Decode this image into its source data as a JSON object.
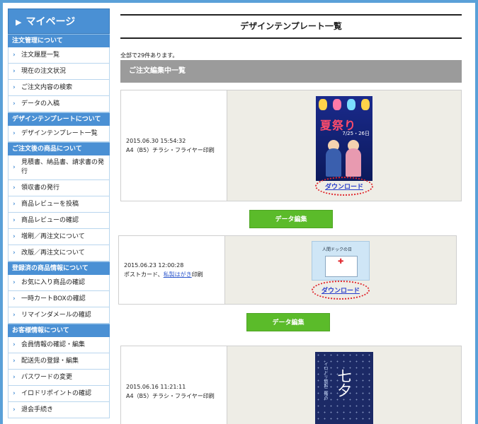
{
  "sidebar": {
    "mypage": "マイページ",
    "sections": [
      {
        "title": "注文管理について",
        "items": [
          "注文履歴一覧",
          "現在の注文状況",
          "ご注文内容の検索",
          "データの入稿"
        ]
      },
      {
        "title": "デザインテンプレートについて",
        "items": [
          "デザインテンプレート一覧"
        ]
      },
      {
        "title": "ご注文後の商品について",
        "items": [
          "見積書、納品書、請求書の発行",
          "領収書の発行",
          "商品レビューを投稿",
          "商品レビューの確認",
          "増刷／再注文について",
          "改版／再注文について"
        ]
      },
      {
        "title": "登録済の商品情報について",
        "items": [
          "お気に入り商品の確認",
          "一時カートBOXの確認",
          "リマインダメールの確認"
        ]
      },
      {
        "title": "お客様情報について",
        "items": [
          "会員情報の確認・編集",
          "配送先の登録・編集",
          "パスワードの変更",
          "イロドリポイントの確認",
          "退会手続き"
        ]
      }
    ]
  },
  "main": {
    "title": "デザインテンプレート一覧",
    "count": "全部で29件あります。",
    "banner": "ご注文編集中一覧",
    "download_label": "ダウンロード",
    "edit_label": "データ編集",
    "orders": [
      {
        "datetime": "2015.06.30 15:54:32",
        "product": "A4（B5）チラシ・フライヤー印刷",
        "poster_title": "夏祭り",
        "poster_date": "7/25・26日"
      },
      {
        "datetime": "2015.06.23 12:00:28",
        "product_prefix": "ポストカード、",
        "product_link": "私製はがき",
        "product_suffix": "印刷",
        "poster_text": "人間ドックの日"
      },
      {
        "datetime": "2015.06.16 11:21:11",
        "product": "A4（B5）チラシ・フライヤー印刷",
        "poster_title": "七夕",
        "poster_sub": "イロドリ旅館二階の"
      }
    ]
  },
  "colors": {
    "accent": "#4a90d4",
    "edit_button": "#5bbb2a",
    "banner": "#9b9b9b",
    "download_circle": "#e0262c"
  }
}
